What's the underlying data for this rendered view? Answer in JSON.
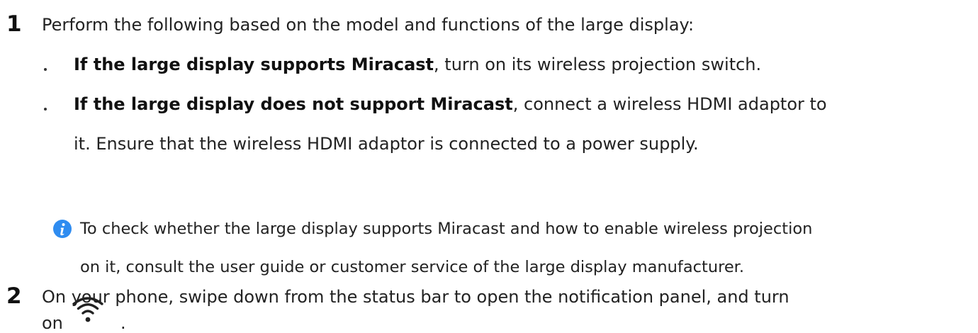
{
  "step1": {
    "number": "1",
    "intro": "Perform the following based on the model and functions of the large display:",
    "bullets": [
      {
        "bold": "If the large display supports Miracast",
        "text": ", turn on its wireless projection switch."
      },
      {
        "bold": "If the large display does not support Miracast",
        "text": ", connect a wireless HDMI adaptor to",
        "continuation": "it. Ensure that the wireless HDMI adaptor is connected to a power supply."
      }
    ],
    "note": {
      "icon": "info-icon",
      "line1": "To check whether the large display supports Miracast and how to enable wireless projection",
      "line2": "on it, consult the user guide or customer service of the large display manufacturer."
    }
  },
  "step2": {
    "number": "2",
    "line1": "On your phone, swipe down from the status bar to open the notification panel, and turn",
    "line2_prefix": "on",
    "icon": "wifi-icon",
    "line2_suffix": "."
  },
  "colors": {
    "text": "#222222",
    "info_icon": "#2f8cf0"
  }
}
